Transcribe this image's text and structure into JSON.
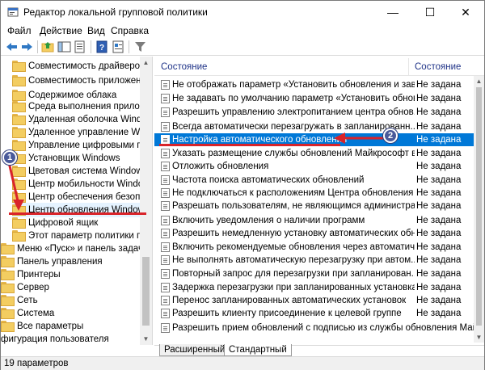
{
  "window": {
    "title": "Редактор локальной групповой политики",
    "minimize": "—",
    "maximize": "☐",
    "close": "✕"
  },
  "menu": {
    "items": [
      "Файл",
      "Действие",
      "Вид",
      "Справка"
    ]
  },
  "toolbar": {
    "icons": [
      "back-icon",
      "forward-icon",
      "up-folder-icon",
      "show-hide-tree-icon",
      "export-list-icon",
      "help-icon",
      "properties-icon",
      "filter-icon"
    ]
  },
  "tree": {
    "items": [
      "Совместимость драйверов и",
      "Совместимость приложений",
      "Содержимое облака",
      "Среда выполнения приложен",
      "Удаленная оболочка Window",
      "Удаленное управление Windo",
      "Управление цифровыми прав",
      "Установщик Windows",
      "Цветовая система Windows C",
      "Центр мобильности Windows",
      "Центр обеспечения безопасн",
      "Центр обновления Windows",
      "Цифровой ящик",
      "Этот параметр политики пер",
      "Меню «Пуск» и панель задач",
      "Панель управления",
      "Принтеры",
      "Сервер",
      "Сеть",
      "Система",
      "Все параметры",
      "фигурация пользователя"
    ],
    "selected": "Центр обновления Windows"
  },
  "list": {
    "columns": [
      "Состояние",
      "Состояние"
    ],
    "rows": [
      {
        "name": "Не отображать параметр «Установить обновления и заве...",
        "state": "Не задана"
      },
      {
        "name": "Не задавать по умолчанию параметр «Установить обновл...",
        "state": "Не задана"
      },
      {
        "name": "Разрешить управлению электропитанием центра обнов...",
        "state": "Не задана"
      },
      {
        "name": "Всегда автоматически перезагружать в запланированн...",
        "state": "Не задана"
      },
      {
        "name": "Настройка автоматического обновления",
        "state": "Не задана"
      },
      {
        "name": "Указать размещение службы обновлений Майкрософт в ...",
        "state": "Не задана"
      },
      {
        "name": "Отложить обновления",
        "state": "Не задана"
      },
      {
        "name": "Частота поиска автоматических обновлений",
        "state": "Не задана"
      },
      {
        "name": "Не подключаться к расположениям Центра обновления ...",
        "state": "Не задана"
      },
      {
        "name": "Разрешать пользователям, не являющимся администрат...",
        "state": "Не задана"
      },
      {
        "name": "Включить уведомления о наличии программ",
        "state": "Не задана"
      },
      {
        "name": "Разрешить немедленную установку автоматических обн...",
        "state": "Не задана"
      },
      {
        "name": "Включить рекомендуемые обновления через автоматич...",
        "state": "Не задана"
      },
      {
        "name": "Не выполнять автоматическую перезагрузку при автом...",
        "state": "Не задана"
      },
      {
        "name": "Повторный запрос для перезагрузки при запланирован...",
        "state": "Не задана"
      },
      {
        "name": "Задержка перезагрузки при запланированных установках",
        "state": "Не задана"
      },
      {
        "name": "Перенос запланированных автоматических установок",
        "state": "Не задана"
      },
      {
        "name": "Разрешить клиенту присоединение к целевой группе",
        "state": "Не задана"
      },
      {
        "name": "Разрешить прием обновлений с подписью из службы обновления Майкрософт в",
        "state": ""
      }
    ],
    "selected_index": 4
  },
  "tabs": [
    "Расширенный",
    "Стандартный"
  ],
  "status": "19 параметров",
  "annotations": {
    "badge1": "1",
    "badge2": "2",
    "color": "#d9242a"
  }
}
